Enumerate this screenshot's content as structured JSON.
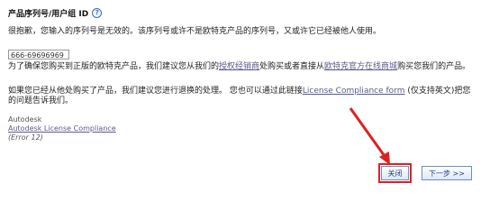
{
  "dialog": {
    "title": "产品序列号/用户组 ID",
    "help_icon": "help-icon",
    "message": "很抱歉，您输入的序列号是无效的。该序列号或许不是欧特克产品的序列号，又或许它已经被他人使用。",
    "serial_value": "666-69696969",
    "advice_prefix": "为了确保您购买到正版的欧特克产品，我们建议您从我们的",
    "reseller_link": "授权经销商",
    "advice_mid": "处购买或者直接从",
    "store_link": "欧特克官方在线商城",
    "advice_suffix": "购买您我们的产品。",
    "refund_line1_prefix": "如果您已经从他处购买了产品，我们建议您进行退换的处理。 您也可以通过此链接",
    "compliance_link_inline": "License Compliance form",
    "refund_line1_suffix": " (仅支持英文)把您",
    "refund_line2": "的问题告诉我们。",
    "company": "Autodesk",
    "compliance_link": "Autodesk License Compliance",
    "error_code": "(Error 12)"
  },
  "buttons": {
    "close_label": "关闭",
    "next_label": "下一步 >>"
  },
  "colors": {
    "annotation": "#e02020",
    "link": "#5a5a8a",
    "button_text": "#1a3f86"
  }
}
